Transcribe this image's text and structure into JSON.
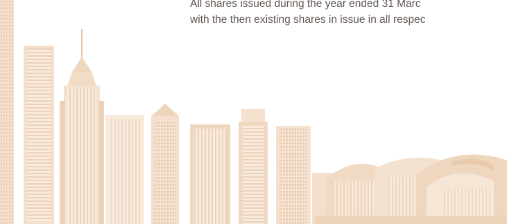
{
  "document": {
    "lines": [
      "All shares issued during the year ended 31 Marc",
      "with the then existing shares in issue in all respec"
    ]
  },
  "illustration": {
    "name": "city-skyline-illustration",
    "color": "#f2dcc7",
    "color_light": "#f8ece0",
    "color_dark": "#e8c9ab"
  }
}
